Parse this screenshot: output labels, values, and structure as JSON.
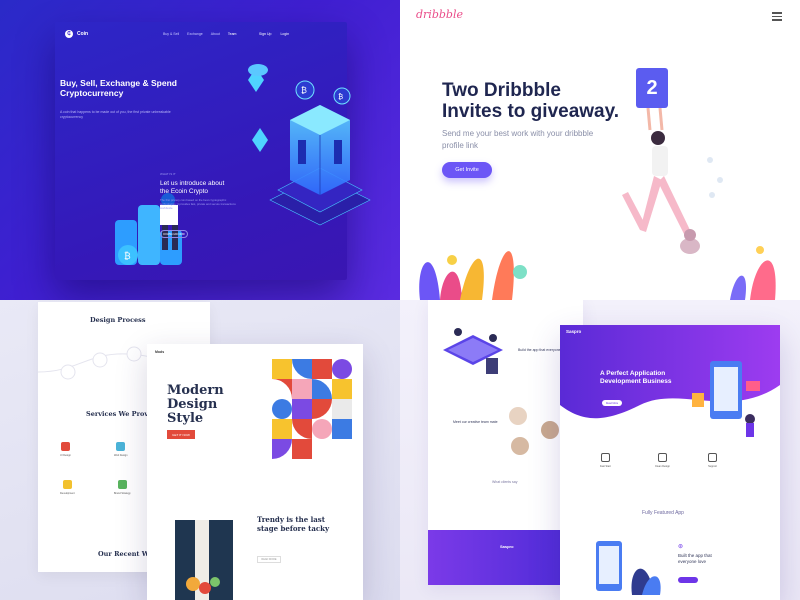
{
  "quadrants": {
    "crypto": {
      "logo": "Coin",
      "nav": [
        "Buy & Sell",
        "Exchange",
        "About",
        "Team"
      ],
      "auth": [
        "Sign Up",
        "Login"
      ],
      "headline": "Buy, Sell, Exchange & Spend Cryptocurrency",
      "subtext": "A coin that happens to be made out of you, the first private unbreakable cryptocurrency",
      "intro_kicker": "WHAT IS IT",
      "intro_title": "Let us introduce about the Ecoin Crypto",
      "intro_para": "The first privacy coin based on the best cryptographic technologies; it provides fast, private and secure transactions worldwide.",
      "intro_button": "DOWNLOAD NOW",
      "coin_symbol": "B"
    },
    "dribbble": {
      "logo": "dribbble",
      "headline": "Two Dribbble Invites to giveaway.",
      "subtext": "Send me your best work with your dribbble profile link",
      "button": "Get Invite",
      "sign_number": "2"
    },
    "design": {
      "process_title": "Design Process",
      "services_title": "Services We Provide",
      "services": [
        "UI Design",
        "Web Design",
        "Development",
        "Brand Strategy"
      ],
      "recent_title": "Our Recent Work",
      "logo": "Mods",
      "headline": "Modern Design Style",
      "button": "GET IT NOW",
      "trendy": "Trendy is the last stage before tacky",
      "trendy_button": "READ MORE"
    },
    "saas": {
      "logo": "Saspro",
      "headline": "A Perfect Application Development Business",
      "button": "Read More",
      "features": [
        "Fast Start",
        "Clean Design",
        "Support"
      ],
      "featured_title": "Fully Featured App",
      "built_text": "Built the app that everyone love",
      "left_title_1": "Build the app that everyone love",
      "left_title_2": "Meet our creative team mate",
      "clients_title": "What clients say",
      "footer_logo": "Saspro"
    }
  },
  "colors": {
    "crypto_bg": "#3a1fd0",
    "dribbble_pink": "#ea4c89",
    "dribbble_button": "#6c56f6",
    "design_accent": "#e24a3b",
    "saas_purple": "#6d35e8"
  }
}
